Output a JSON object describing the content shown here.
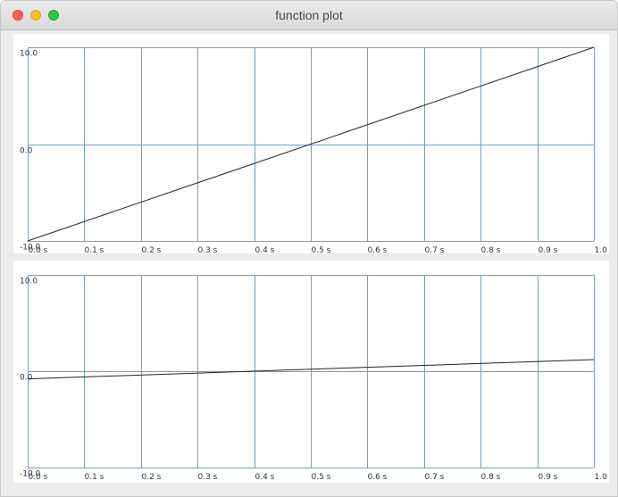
{
  "window": {
    "title": "function plot"
  },
  "colors": {
    "grid": "#7a9cc4",
    "curve": "#222222",
    "panel_background": "#ffffff",
    "window_background": "#ececec"
  },
  "chart_data": [
    {
      "type": "line",
      "title": "",
      "xlabel": "",
      "ylabel": "",
      "xlim": [
        0.0,
        1.0
      ],
      "ylim": [
        -10.0,
        10.0
      ],
      "grid": true,
      "x_ticks": [
        "0.0 s",
        "0.1 s",
        "0.2 s",
        "0.3 s",
        "0.4 s",
        "0.5 s",
        "0.6 s",
        "0.7 s",
        "0.8 s",
        "0.9 s",
        "1.0"
      ],
      "y_ticks": [
        "10.0",
        "0.0",
        "-10.0"
      ],
      "series": [
        {
          "x": [
            0.0,
            1.0
          ],
          "y": [
            -10.0,
            10.0
          ]
        }
      ]
    },
    {
      "type": "line",
      "title": "",
      "xlabel": "",
      "ylabel": "",
      "xlim": [
        0.0,
        1.0
      ],
      "ylim": [
        -10.0,
        10.0
      ],
      "grid": true,
      "x_ticks": [
        "0.0 s",
        "0.1 s",
        "0.2 s",
        "0.3 s",
        "0.4 s",
        "0.5 s",
        "0.6 s",
        "0.7 s",
        "0.8 s",
        "0.9 s",
        "1.0"
      ],
      "y_ticks": [
        "10.0",
        "0.0",
        "-10.0"
      ],
      "series": [
        {
          "x": [
            0.0,
            1.0
          ],
          "y": [
            -0.8,
            1.2
          ]
        }
      ]
    }
  ]
}
